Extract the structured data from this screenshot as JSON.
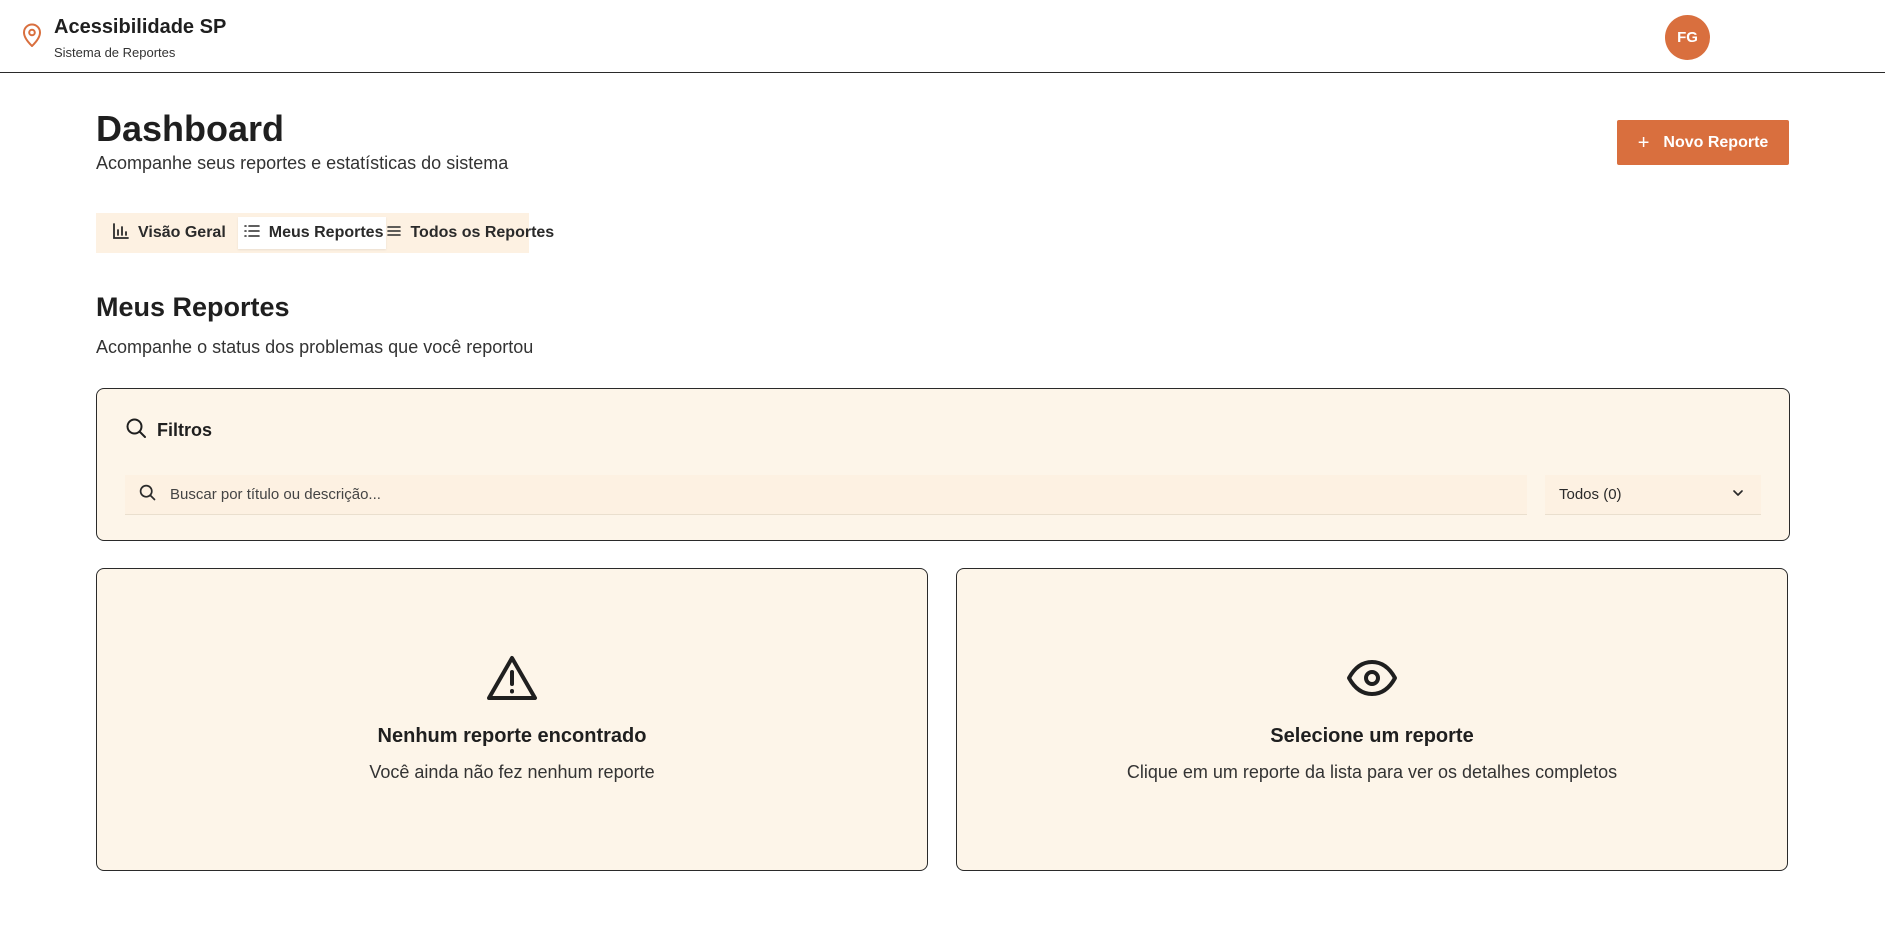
{
  "header": {
    "brand_title": "Acessibilidade SP",
    "brand_subtitle": "Sistema de Reportes",
    "avatar_initials": "FG",
    "brand_icon": "map-pin-icon"
  },
  "page": {
    "title": "Dashboard",
    "subtitle": "Acompanhe seus reportes e estatísticas do sistema",
    "new_button_label": "Novo Reporte"
  },
  "tabs": [
    {
      "label": "Visão Geral",
      "icon": "bar-chart-icon",
      "active": false
    },
    {
      "label": "Meus Reportes",
      "icon": "list-icon",
      "active": true
    },
    {
      "label": "Todos os Reportes",
      "icon": "menu-icon",
      "active": false
    }
  ],
  "section": {
    "title": "Meus Reportes",
    "subtitle": "Acompanhe o status dos problemas que você reportou"
  },
  "filters": {
    "title": "Filtros",
    "search_placeholder": "Buscar por título ou descrição...",
    "search_value": "",
    "status_selected": "Todos (0)"
  },
  "empty_list": {
    "title": "Nenhum reporte encontrado",
    "text": "Você ainda não fez nenhum reporte",
    "icon": "warning-icon"
  },
  "empty_detail": {
    "title": "Selecione um reporte",
    "text": "Clique em um reporte da lista para ver os detalhes completos",
    "icon": "eye-icon"
  },
  "colors": {
    "accent": "#d96f3e",
    "panel_bg": "#fdf5e9",
    "tab_bg": "#fdf1e2",
    "text": "#1f1f1f"
  }
}
